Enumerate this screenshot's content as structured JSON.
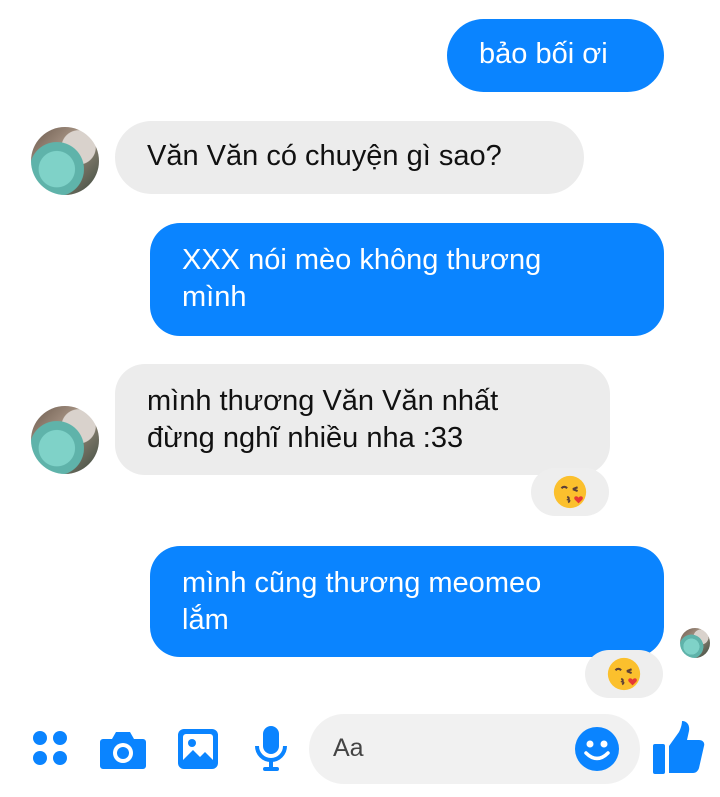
{
  "messages": [
    {
      "from": "me",
      "text": "bảo bối ơi"
    },
    {
      "from": "them",
      "text": "Văn Văn có chuyện gì sao?"
    },
    {
      "from": "me",
      "lines": [
        "XXX nói mèo không thương",
        "mình"
      ]
    },
    {
      "from": "them",
      "lines": [
        "mình thương Văn Văn nhất",
        "đừng nghĩ nhiều nha :33"
      ],
      "reaction": "kissing-heart-emoji"
    },
    {
      "from": "me",
      "lines": [
        "mình cũng thương meomeo",
        "lắm"
      ],
      "reaction": "kissing-heart-emoji"
    }
  ],
  "composer": {
    "placeholder": "Aa",
    "icons": [
      "grid-menu-icon",
      "camera-icon",
      "gallery-icon",
      "microphone-icon",
      "emoji-icon",
      "thumbs-up-icon"
    ]
  },
  "colors": {
    "accent": "#0a84ff",
    "incoming_bubble": "#ececec",
    "outgoing_text": "#ffffff"
  }
}
